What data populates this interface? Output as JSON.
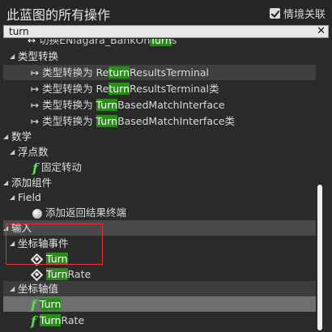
{
  "header": {
    "title": "此蓝图的所有操作",
    "context_label": "情境关联",
    "context_checked": true
  },
  "search": {
    "value": "turn"
  },
  "list": {
    "r0": {
      "pre": "切换ENiagara_BankOn",
      "hl": "Turn",
      "post": "s"
    },
    "r1": {
      "label": "类型转换"
    },
    "r2": {
      "pre": "类型转换为 Re",
      "hl": "turn",
      "post": "ResultsTerminal"
    },
    "r3": {
      "pre": "类型转换为 Re",
      "hl": "turn",
      "post": "ResultsTerminal类"
    },
    "r4": {
      "pre": "类型转换为 ",
      "hl": "Turn",
      "post": "BasedMatchInterface"
    },
    "r5": {
      "pre": "类型转换为 ",
      "hl": "Turn",
      "post": "BasedMatchInterface类"
    },
    "r6": {
      "label": "数学"
    },
    "r7": {
      "label": "浮点数"
    },
    "r8": {
      "label": "固定转动"
    },
    "r9": {
      "label": "添加组件"
    },
    "r10": {
      "label": "Field"
    },
    "r11": {
      "label": "添加返回结果终端"
    },
    "r12": {
      "label": "输入"
    },
    "r13": {
      "label": "坐标轴事件"
    },
    "r14": {
      "hl": "Turn",
      "post": ""
    },
    "r15": {
      "hl": "Turn",
      "post": "Rate"
    },
    "r16": {
      "label": "坐标轴值"
    },
    "r17": {
      "hl": "Turn",
      "post": ""
    },
    "r18": {
      "hl": "Turn",
      "post": "Rate"
    }
  },
  "colors": {
    "highlight": "#2d8a1c",
    "function_icon": "#5ddc50",
    "annotation_box": "#e03434"
  }
}
